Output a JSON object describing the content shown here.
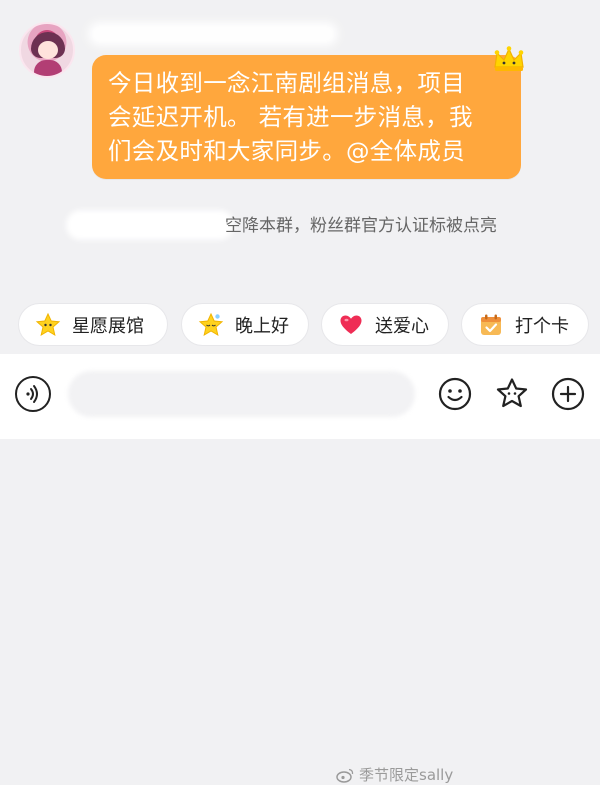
{
  "message": {
    "text": "今日收到一念江南剧组消息，项目\n会延迟开机。 若有进一步消息，我\n们会及时和大家同步。@全体成员"
  },
  "notice": {
    "text": "空降本群，粉丝群官方认证标被点亮"
  },
  "quick_actions": [
    {
      "label": "星愿展馆",
      "icon": "star-face-icon"
    },
    {
      "label": "晚上好",
      "icon": "sleepy-star-icon"
    },
    {
      "label": "送爱心",
      "icon": "heart-icon"
    },
    {
      "label": "打个卡",
      "icon": "calendar-check-icon"
    }
  ],
  "input_bar": {
    "icons": [
      "voice-icon",
      "emoji-icon",
      "star-icon",
      "plus-icon"
    ]
  },
  "watermark": {
    "text": "季节限定sally"
  },
  "colors": {
    "bubble": "#ffa73d",
    "background": "#f1f1f3",
    "chip_background": "#ffffff"
  }
}
